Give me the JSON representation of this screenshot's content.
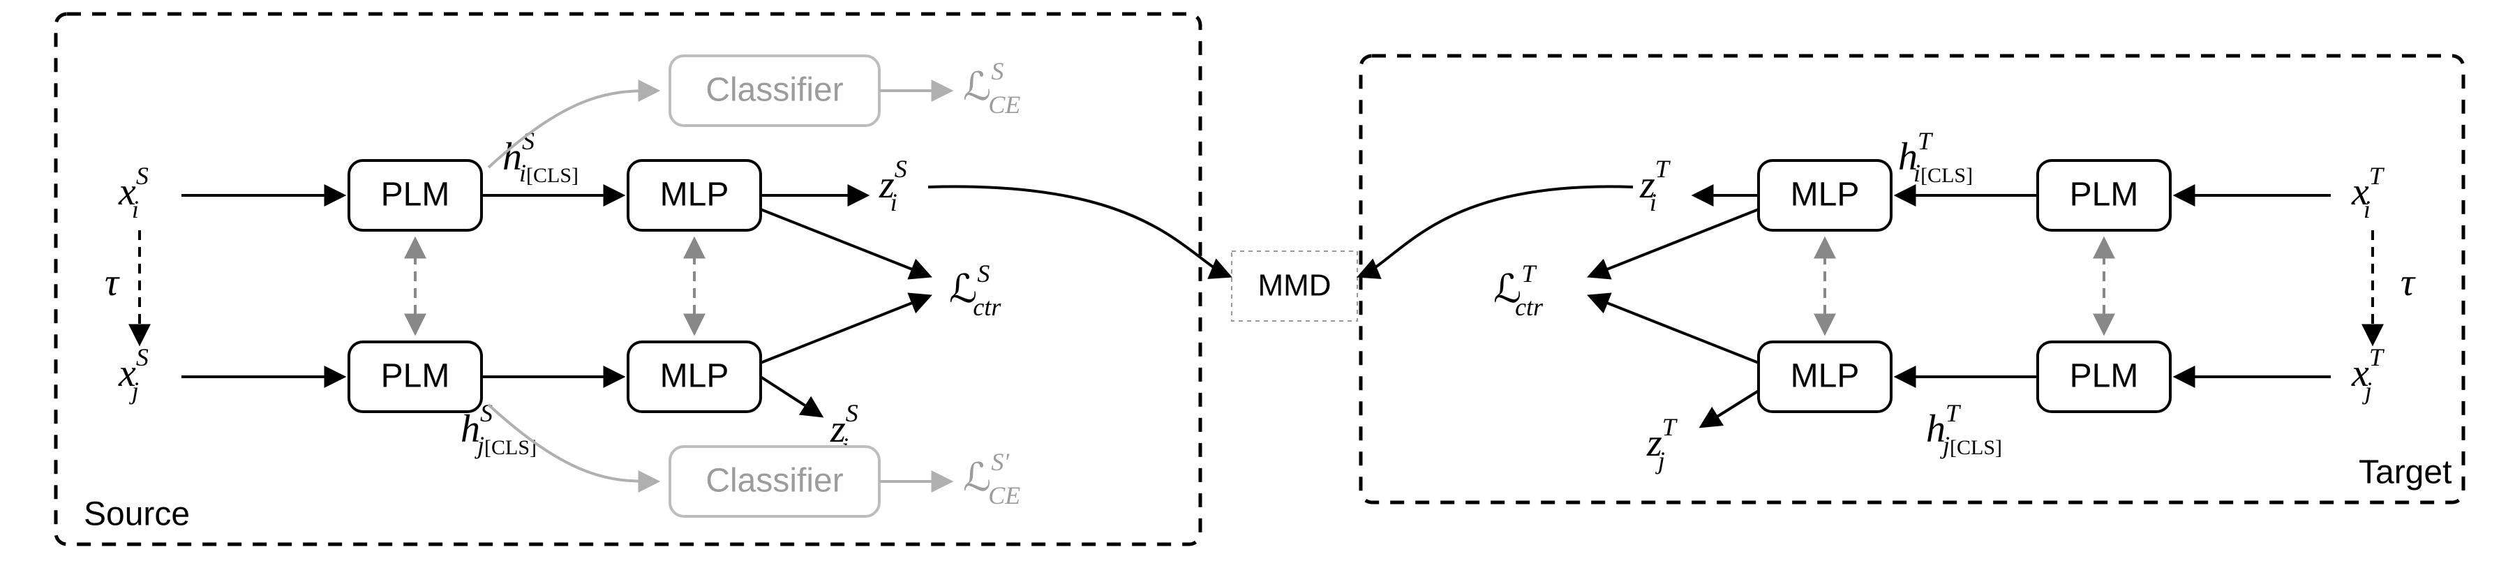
{
  "panels": {
    "source": "Source",
    "target": "Target"
  },
  "blocks": {
    "plm": "PLM",
    "mlp": "MLP",
    "classifier": "Classifier",
    "mmd": "MMD"
  },
  "symbols": {
    "tau": "τ",
    "L_ctr_S": "ℒ",
    "L_ctr_S_sub": "ctr",
    "L_ctr_S_sup": "S",
    "L_ctr_T": "ℒ",
    "L_ctr_T_sub": "ctr",
    "L_ctr_T_sup": "T",
    "L_CE_S": "ℒ",
    "L_CE_S_sub": "CE",
    "L_CE_S_sup": "S",
    "L_CE_Sp": "ℒ",
    "L_CE_Sp_sub": "CE",
    "L_CE_Sp_sup": "S′",
    "x": "x",
    "h": "h",
    "z": "z",
    "sub_i": "i",
    "sub_j": "j",
    "sup_S": "S",
    "sup_T": "T",
    "cls": "[CLS]"
  }
}
